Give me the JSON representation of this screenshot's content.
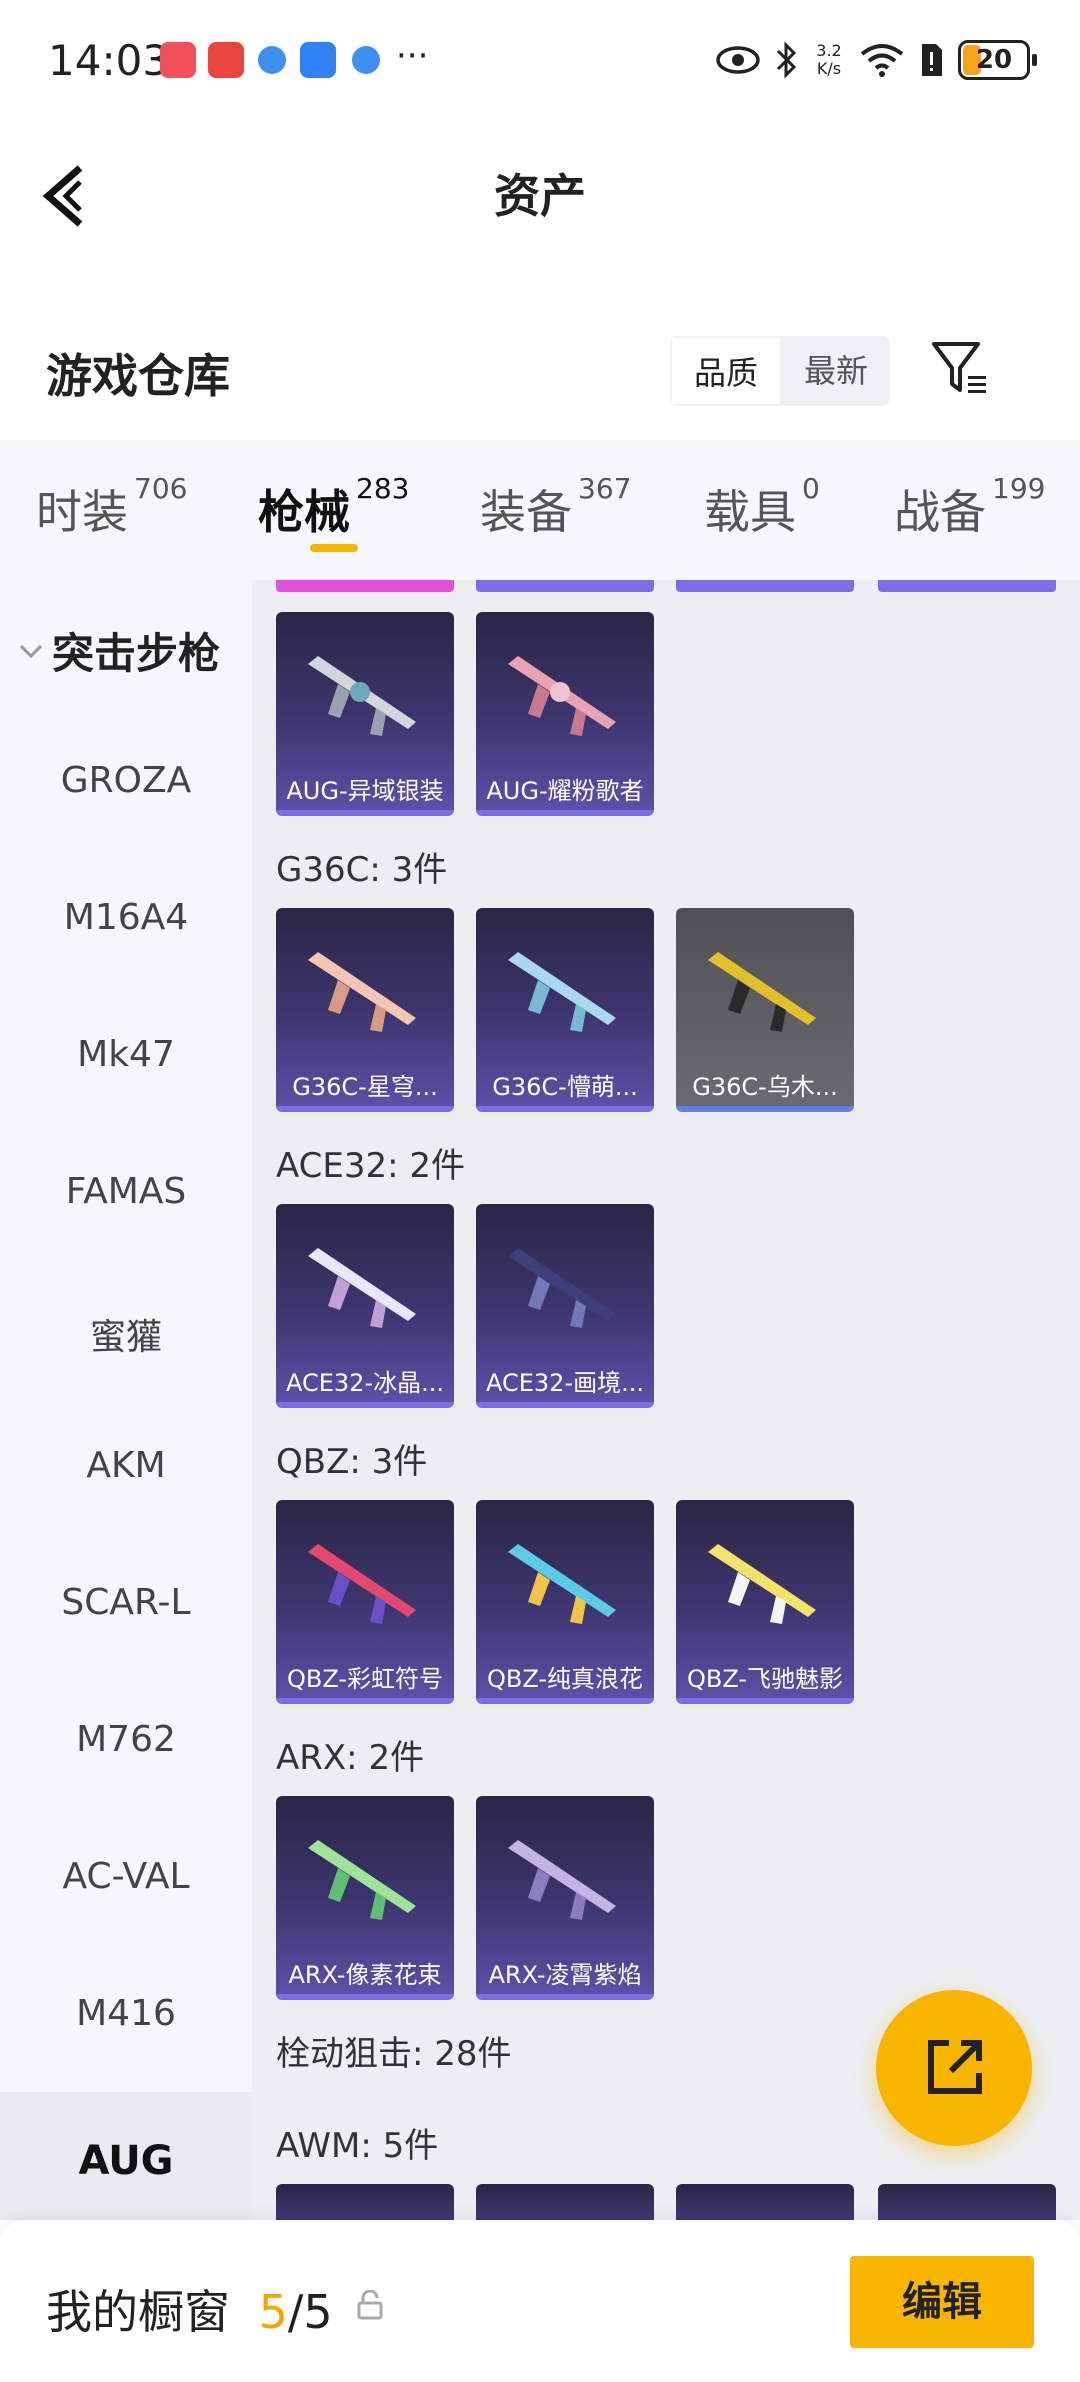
{
  "status_bar": {
    "time": "14:03",
    "net_speed": "3.2 K/s",
    "battery": "20"
  },
  "header": {
    "title": "资产"
  },
  "warehouse": {
    "title": "游戏仓库",
    "sort_options": [
      "品质",
      "最新"
    ]
  },
  "tabs": [
    {
      "label": "时装",
      "count": "706"
    },
    {
      "label": "枪械",
      "count": "283"
    },
    {
      "label": "装备",
      "count": "367"
    },
    {
      "label": "载具",
      "count": "0"
    },
    {
      "label": "战备",
      "count": "199"
    }
  ],
  "sidebar": {
    "group": "突击步枪",
    "items": [
      "GROZA",
      "M16A4",
      "Mk47",
      "FAMAS",
      "蜜獾",
      "AKM",
      "SCAR-L",
      "M762",
      "AC-VAL",
      "M416",
      "AUG"
    ]
  },
  "sections": [
    {
      "title": "",
      "items": [
        "AUG-异域银装",
        "AUG-耀粉歌者"
      ]
    },
    {
      "title": "G36C: 3件",
      "items": [
        "G36C-星穹...",
        "G36C-懵萌...",
        "G36C-乌木..."
      ]
    },
    {
      "title": "ACE32: 2件",
      "items": [
        "ACE32-冰晶...",
        "ACE32-画境..."
      ]
    },
    {
      "title": "QBZ: 3件",
      "items": [
        "QBZ-彩虹符号",
        "QBZ-纯真浪花",
        "QBZ-飞驰魅影"
      ]
    },
    {
      "title": "ARX: 2件",
      "items": [
        "ARX-像素花束",
        "ARX-凌霄紫焰"
      ]
    },
    {
      "title": "栓动狙击: 28件",
      "items": []
    },
    {
      "title": "AWM: 5件",
      "items": []
    }
  ],
  "bottom": {
    "label": "我的橱窗",
    "current": "5",
    "sep": "/",
    "total": "5",
    "edit_label": "编辑"
  },
  "colors": {
    "accent": "#f7b500",
    "card_bg": "#3e3670",
    "card_border": "#7a6ee8"
  }
}
